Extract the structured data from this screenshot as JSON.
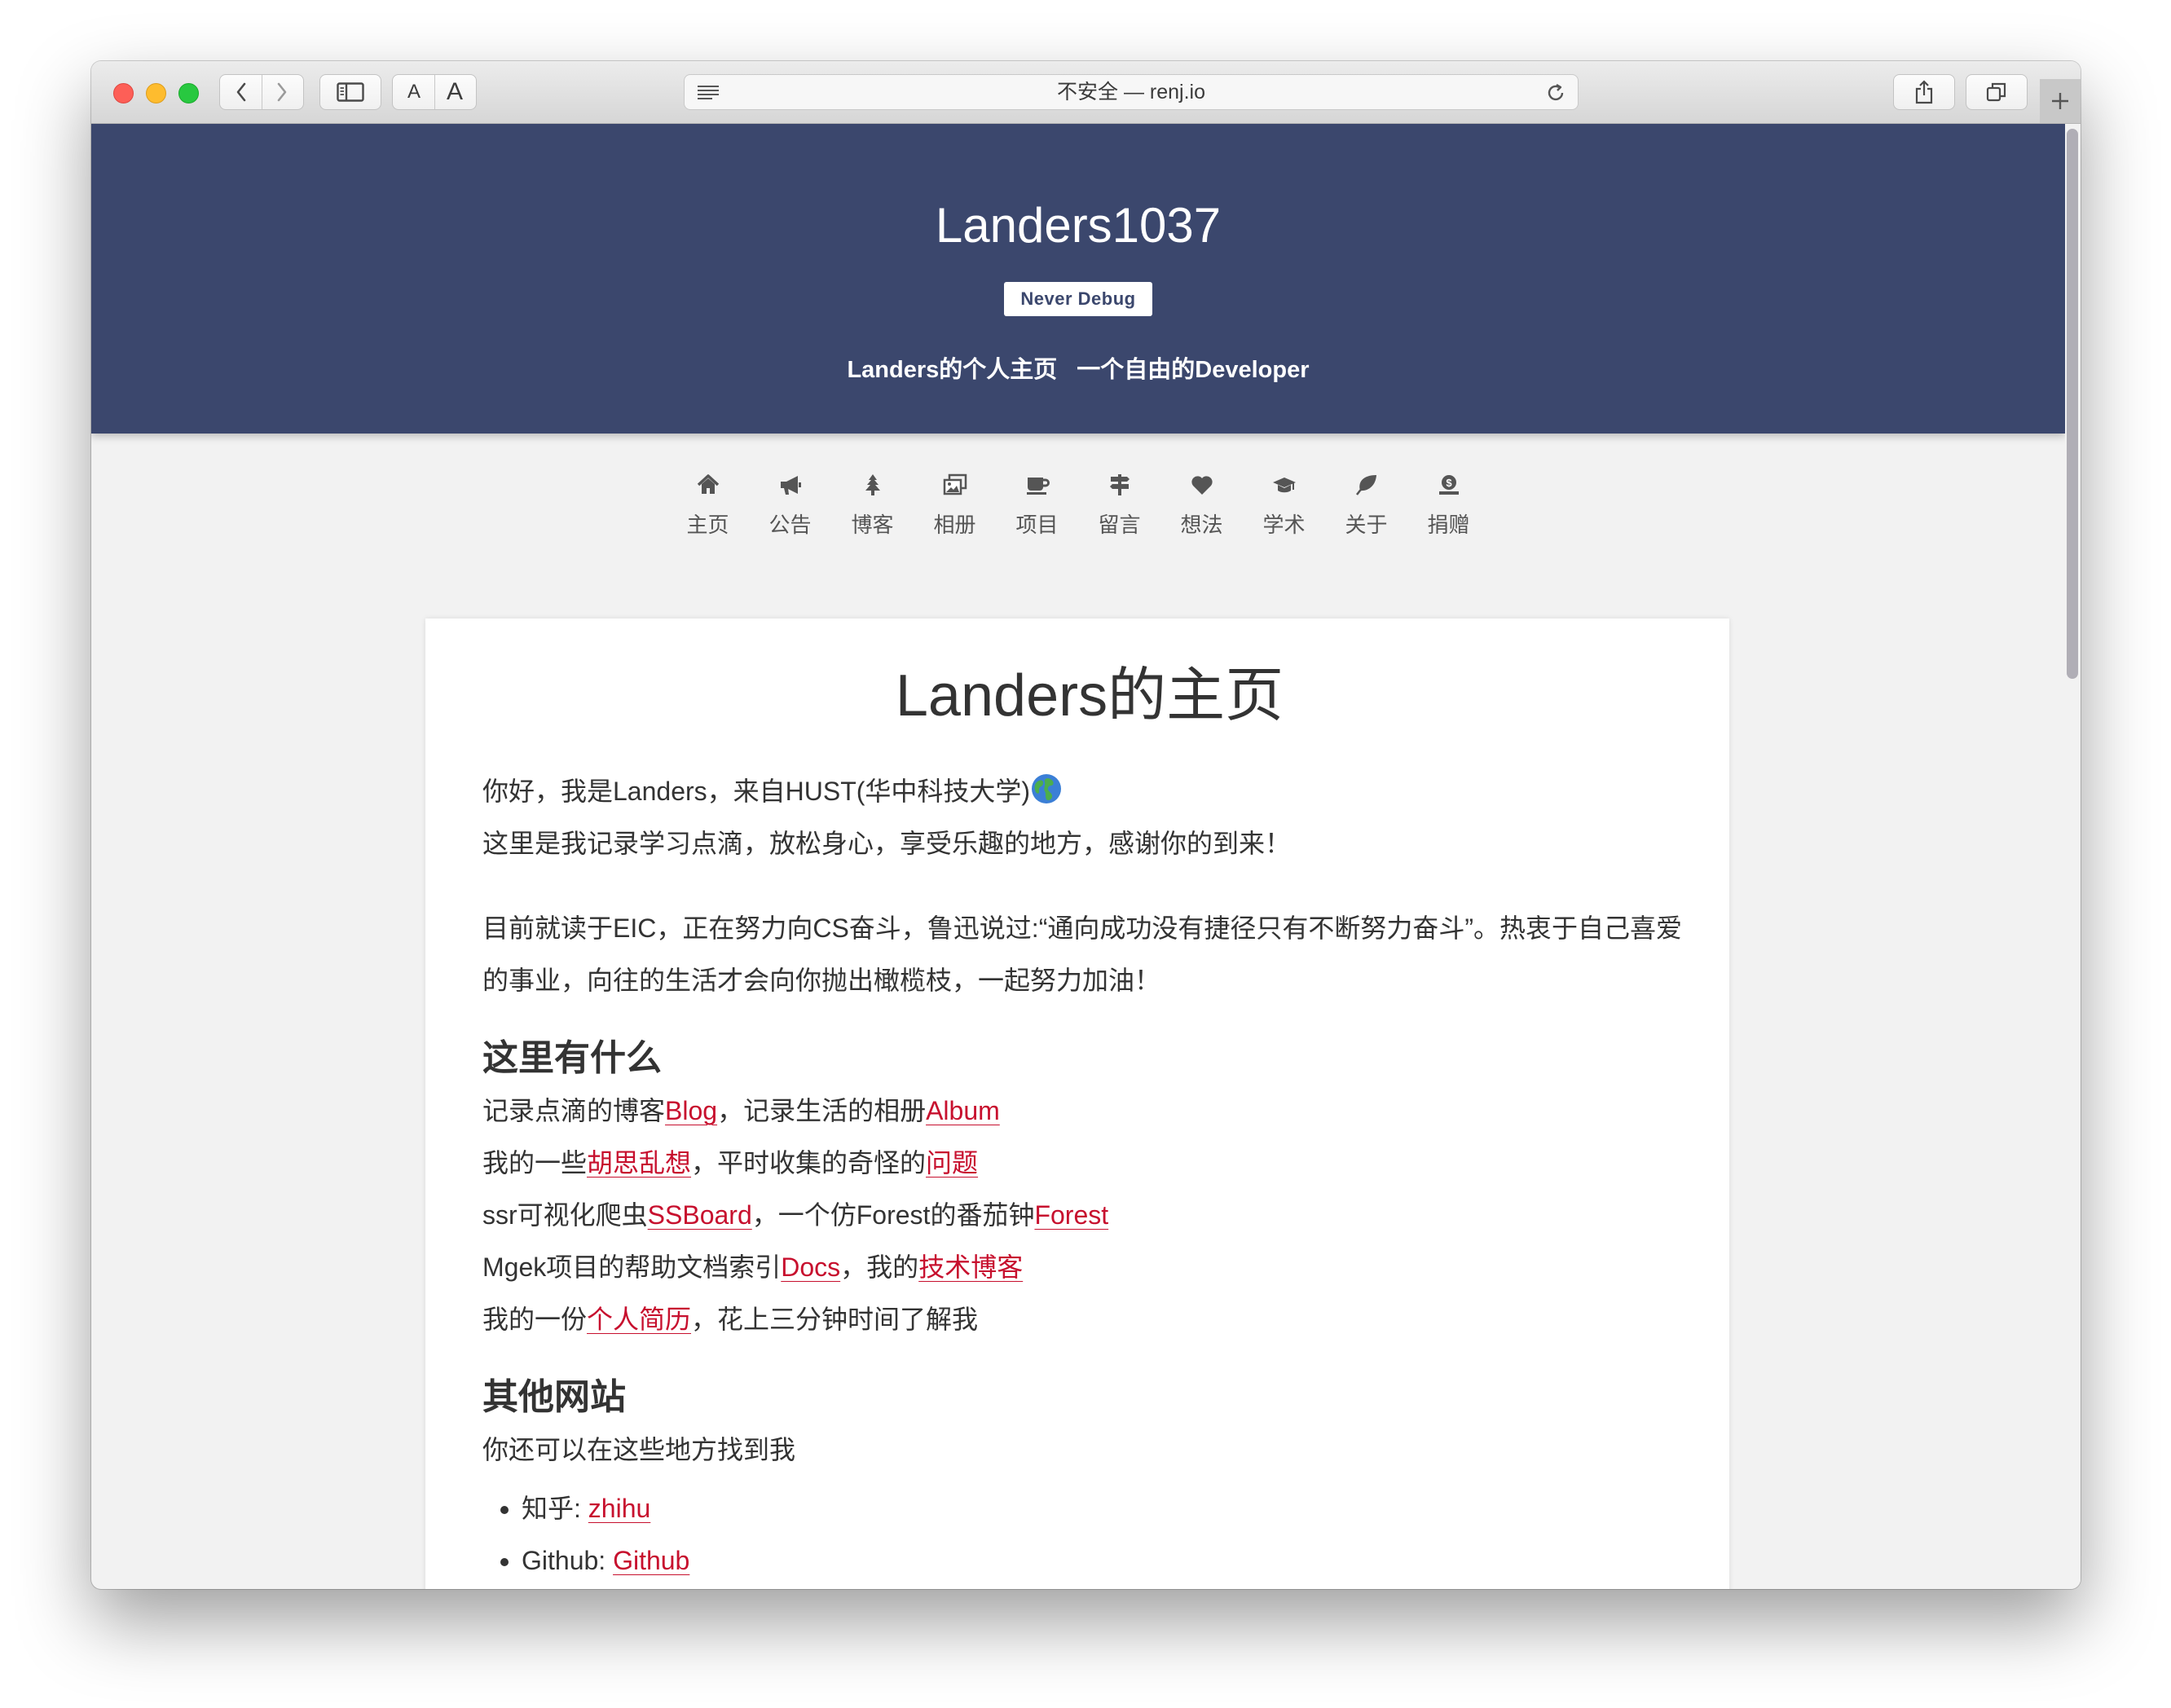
{
  "browser": {
    "address": "不安全 — renj.io",
    "font_small": "A",
    "font_large": "A"
  },
  "hero": {
    "title": "Landers1037",
    "badge": "Never Debug",
    "subtitle_left": "Landers的个人主页",
    "subtitle_right": "一个自由的Developer",
    "bg_color": "#3b476d"
  },
  "nav": [
    {
      "label": "主页",
      "icon": "home-icon"
    },
    {
      "label": "公告",
      "icon": "bullhorn-icon"
    },
    {
      "label": "博客",
      "icon": "tree-icon"
    },
    {
      "label": "相册",
      "icon": "images-icon"
    },
    {
      "label": "项目",
      "icon": "coffee-icon"
    },
    {
      "label": "留言",
      "icon": "signpost-icon"
    },
    {
      "label": "想法",
      "icon": "heart-icon"
    },
    {
      "label": "学术",
      "icon": "graduation-cap-icon"
    },
    {
      "label": "关于",
      "icon": "leaf-icon"
    },
    {
      "label": "捐赠",
      "icon": "donate-icon"
    }
  ],
  "content": {
    "title": "Landers的主页",
    "intro1": "你好，我是Landers，来自HUST(华中科技大学)",
    "intro2": "这里是我记录学习点滴，放松身心，享受乐趣的地方，感谢你的到来！",
    "para": "目前就读于EIC，正在努力向CS奋斗，鲁迅说过:“通向成功没有捷径只有不断努力奋斗”。热衷于自己喜爱的事业，向往的生活才会向你抛出橄榄枝，一起努力加油！",
    "whats_here": {
      "heading": "这里有什么",
      "line1": {
        "t1": "记录点滴的博客",
        "l1": "Blog",
        "t2": "，记录生活的相册",
        "l2": "Album"
      },
      "line2": {
        "t1": "我的一些",
        "l1": "胡思乱想",
        "t2": "，平时收集的奇怪的",
        "l2": "问题"
      },
      "line3": {
        "t1": "ssr可视化爬虫",
        "l1": "SSBoard",
        "t2": "，一个仿Forest的番茄钟",
        "l2": "Forest"
      },
      "line4": {
        "t1": "Mgek项目的帮助文档索引",
        "l1": "Docs",
        "t2": "，我的",
        "l2": "技术博客"
      },
      "line5": {
        "t1": "我的一份",
        "l1": "个人简历",
        "t2": "，花上三分钟时间了解我"
      }
    },
    "other_sites": {
      "heading": "其他网站",
      "desc": "你还可以在这些地方找到我",
      "items": [
        {
          "label": "知乎: ",
          "link": "zhihu"
        },
        {
          "label": "Github: ",
          "link": "Github"
        }
      ]
    },
    "link_color": "#c7102e"
  }
}
